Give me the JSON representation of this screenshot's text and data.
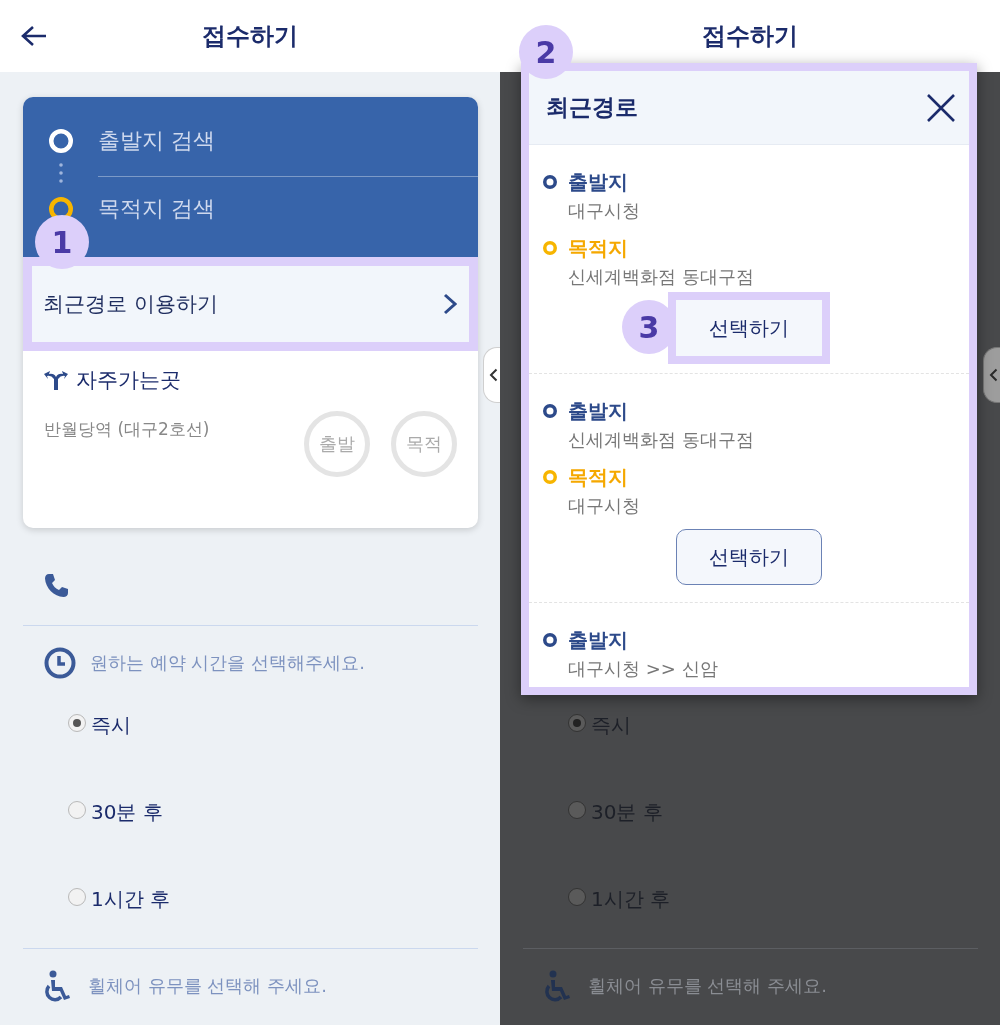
{
  "left_screen": {
    "header": {
      "title": "접수하기"
    },
    "route_search": {
      "origin": {
        "placeholder": "출발지 검색"
      },
      "destination": {
        "placeholder": "목적지 검색"
      }
    },
    "recent_routes_link": {
      "label": "최근경로 이용하기",
      "highlighted": true
    },
    "favorites": {
      "title": "자주가는곳",
      "places": [
        {
          "name": "반월당역 (대구2호선)",
          "origin_button": "출발",
          "destination_button": "목적"
        }
      ]
    },
    "time_prompt": "원하는 예약 시간을 선택해주세요.",
    "time_options": [
      {
        "label": "즉시",
        "selected": true
      },
      {
        "label": "30분 후",
        "selected": false
      },
      {
        "label": "1시간 후",
        "selected": false
      }
    ],
    "wheelchair_prompt": "휠체어 유무를 선택해 주세요."
  },
  "right_screen": {
    "header": {
      "title": "접수하기"
    },
    "time_options": [
      {
        "label": "즉시",
        "selected": true
      },
      {
        "label": "30분 후",
        "selected": false
      },
      {
        "label": "1시간 후",
        "selected": false
      }
    ],
    "wheelchair_prompt": "휠체어 유무를 선택해 주세요.",
    "recent_routes_dialog": {
      "title": "최근경로",
      "highlighted": true,
      "routes": [
        {
          "origin_label": "출발지",
          "origin": "대구시청",
          "destination_label": "목적지",
          "destination": "신세계백화점 동대구점",
          "select_button": {
            "label": "선택하기",
            "highlighted": true
          }
        },
        {
          "origin_label": "출발지",
          "origin": "신세계백화점 동대구점",
          "destination_label": "목적지",
          "destination": "대구시청",
          "select_button": {
            "label": "선택하기",
            "highlighted": false
          }
        },
        {
          "origin_label": "출발지",
          "origin": "대구시청 >> 신암"
        }
      ]
    }
  },
  "callouts": [
    {
      "number": "1"
    },
    {
      "number": "2"
    },
    {
      "number": "3"
    }
  ]
}
